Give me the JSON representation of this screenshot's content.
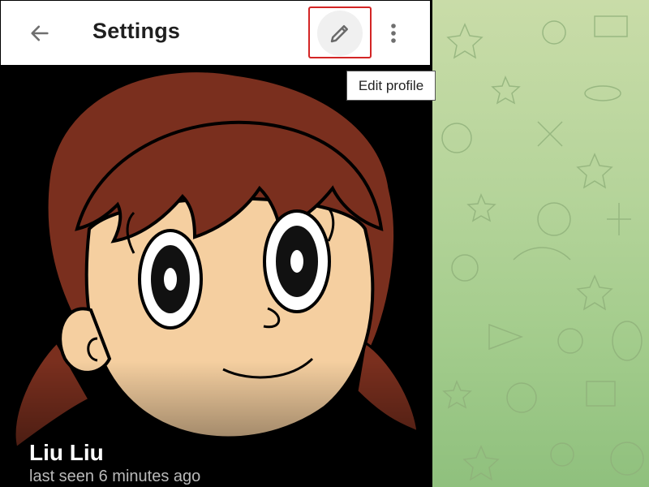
{
  "header": {
    "title": "Settings",
    "back_icon": "arrow-left-icon",
    "edit_icon": "pencil-icon",
    "more_icon": "more-vertical-icon"
  },
  "tooltip": {
    "text": "Edit profile"
  },
  "profile": {
    "name": "Liu Liu",
    "status": "last seen 6 minutes ago"
  },
  "colors": {
    "highlight": "#d32525",
    "wallpaper": "#b5d49a",
    "avatar_background": "#000000"
  }
}
